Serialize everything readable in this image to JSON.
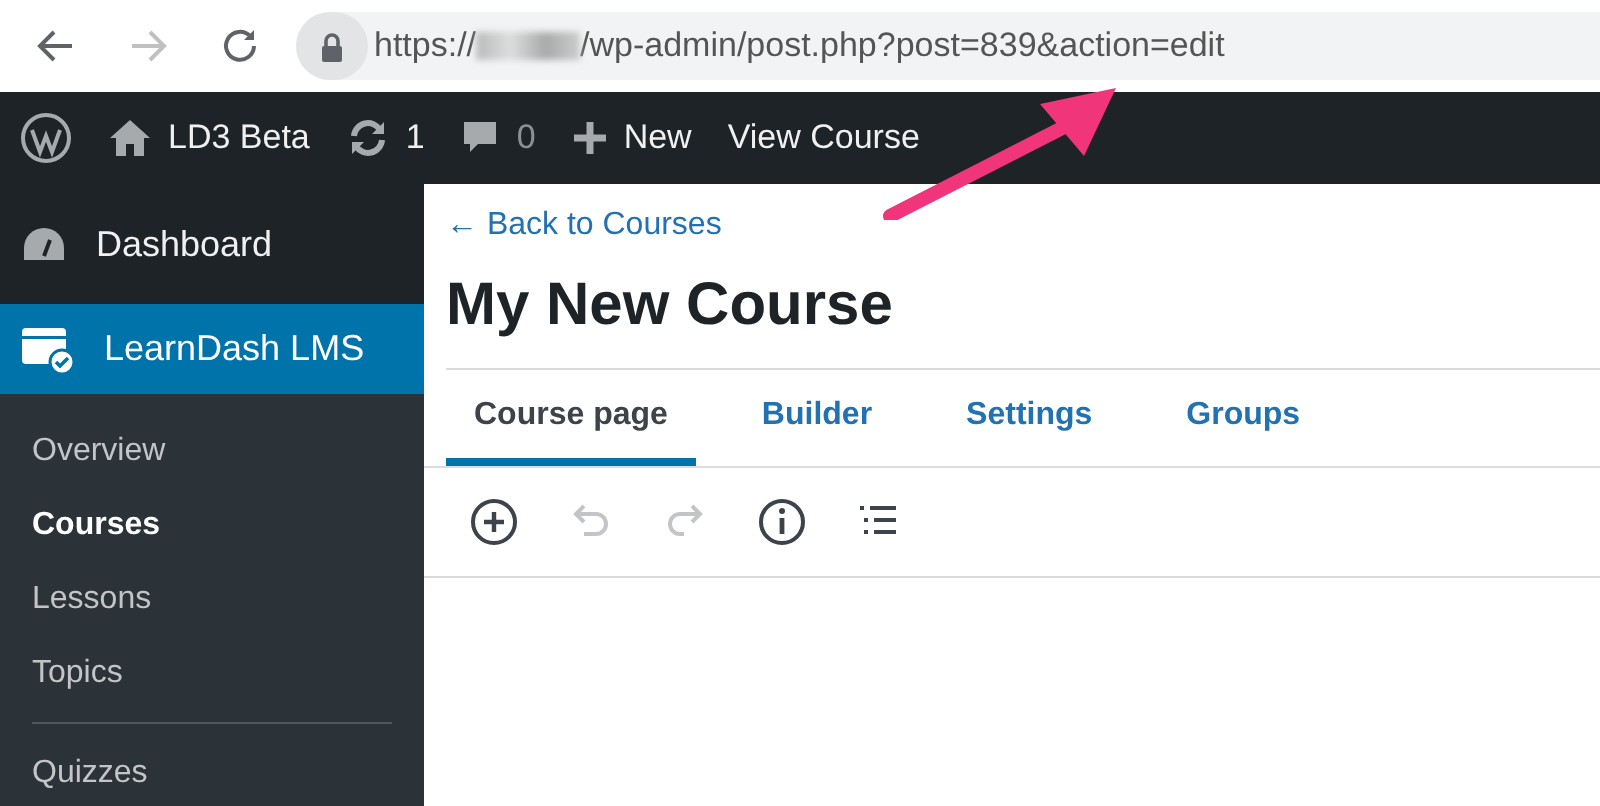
{
  "browser": {
    "url_prefix": "https://",
    "url_suffix": "/wp-admin/post.php?post=839&action=edit",
    "url_redacted": true
  },
  "admin_bar": {
    "site": "LD3 Beta",
    "updates": "1",
    "comments": "0",
    "new": "New",
    "view": "View Course"
  },
  "sidebar": {
    "items": [
      {
        "label": "Dashboard",
        "kind": "dashboard",
        "selected": false
      },
      {
        "label": "LearnDash LMS",
        "kind": "learndash",
        "selected": true
      }
    ],
    "submenu": [
      {
        "label": "Overview",
        "selected": false,
        "kind": "item"
      },
      {
        "label": "Courses",
        "selected": true,
        "kind": "item"
      },
      {
        "label": "Lessons",
        "selected": false,
        "kind": "item"
      },
      {
        "label": "Topics",
        "selected": false,
        "kind": "item"
      },
      {
        "label": "Quizzes",
        "selected": false,
        "kind": "item-after-divider"
      }
    ]
  },
  "back_link": "← Back to Courses",
  "title": "My New Course",
  "tabs": [
    {
      "label": "Course page",
      "selected": true
    },
    {
      "label": "Builder",
      "selected": false
    },
    {
      "label": "Settings",
      "selected": false
    },
    {
      "label": "Groups",
      "selected": false
    }
  ],
  "toolbar": [
    {
      "kind": "add",
      "disabled": false
    },
    {
      "kind": "undo",
      "disabled": true
    },
    {
      "kind": "redo",
      "disabled": true
    },
    {
      "kind": "info",
      "disabled": false
    },
    {
      "kind": "outline",
      "disabled": false
    }
  ],
  "annotation": {
    "kind": "arrow",
    "color": "#f0357a"
  }
}
